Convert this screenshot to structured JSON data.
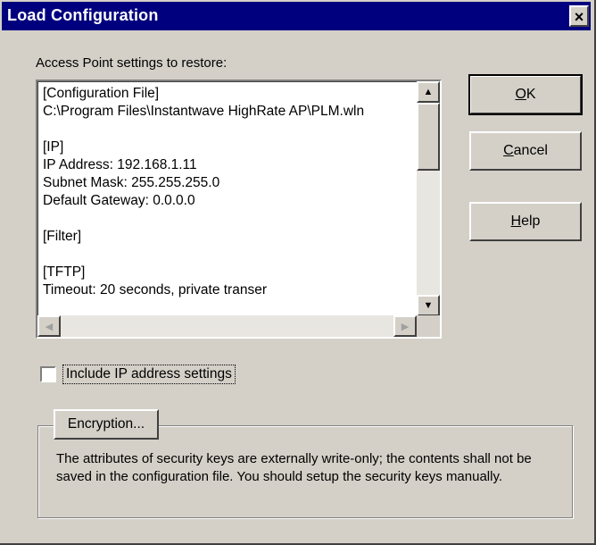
{
  "dialog": {
    "title": "Load Configuration",
    "close_glyph": "×"
  },
  "settings": {
    "label": "Access Point settings to restore:",
    "lines": [
      "[Configuration File]",
      "C:\\Program Files\\Instantwave HighRate AP\\PLM.wln",
      "",
      "[IP]",
      "IP Address: 192.168.1.11",
      "Subnet Mask: 255.255.255.0",
      "Default Gateway: 0.0.0.0",
      "",
      "[Filter]",
      "",
      "[TFTP]",
      "Timeout: 20 seconds, private transer"
    ]
  },
  "scroll": {
    "up_arrow": "▲",
    "down_arrow": "▼",
    "left_arrow": "◀",
    "right_arrow": "▶"
  },
  "buttons": {
    "ok_label": "OK",
    "ok_accel": "O",
    "ok_rest": "K",
    "cancel_accel": "C",
    "cancel_rest": "ancel",
    "help_accel": "H",
    "help_rest": "elp"
  },
  "include_ip": {
    "label": "Include IP address settings",
    "checked": false
  },
  "encryption": {
    "button_label": "Encryption...",
    "note": "The attributes of security keys are externally write-only; the contents shall not be saved in the configuration file. You should setup the security keys manually."
  }
}
